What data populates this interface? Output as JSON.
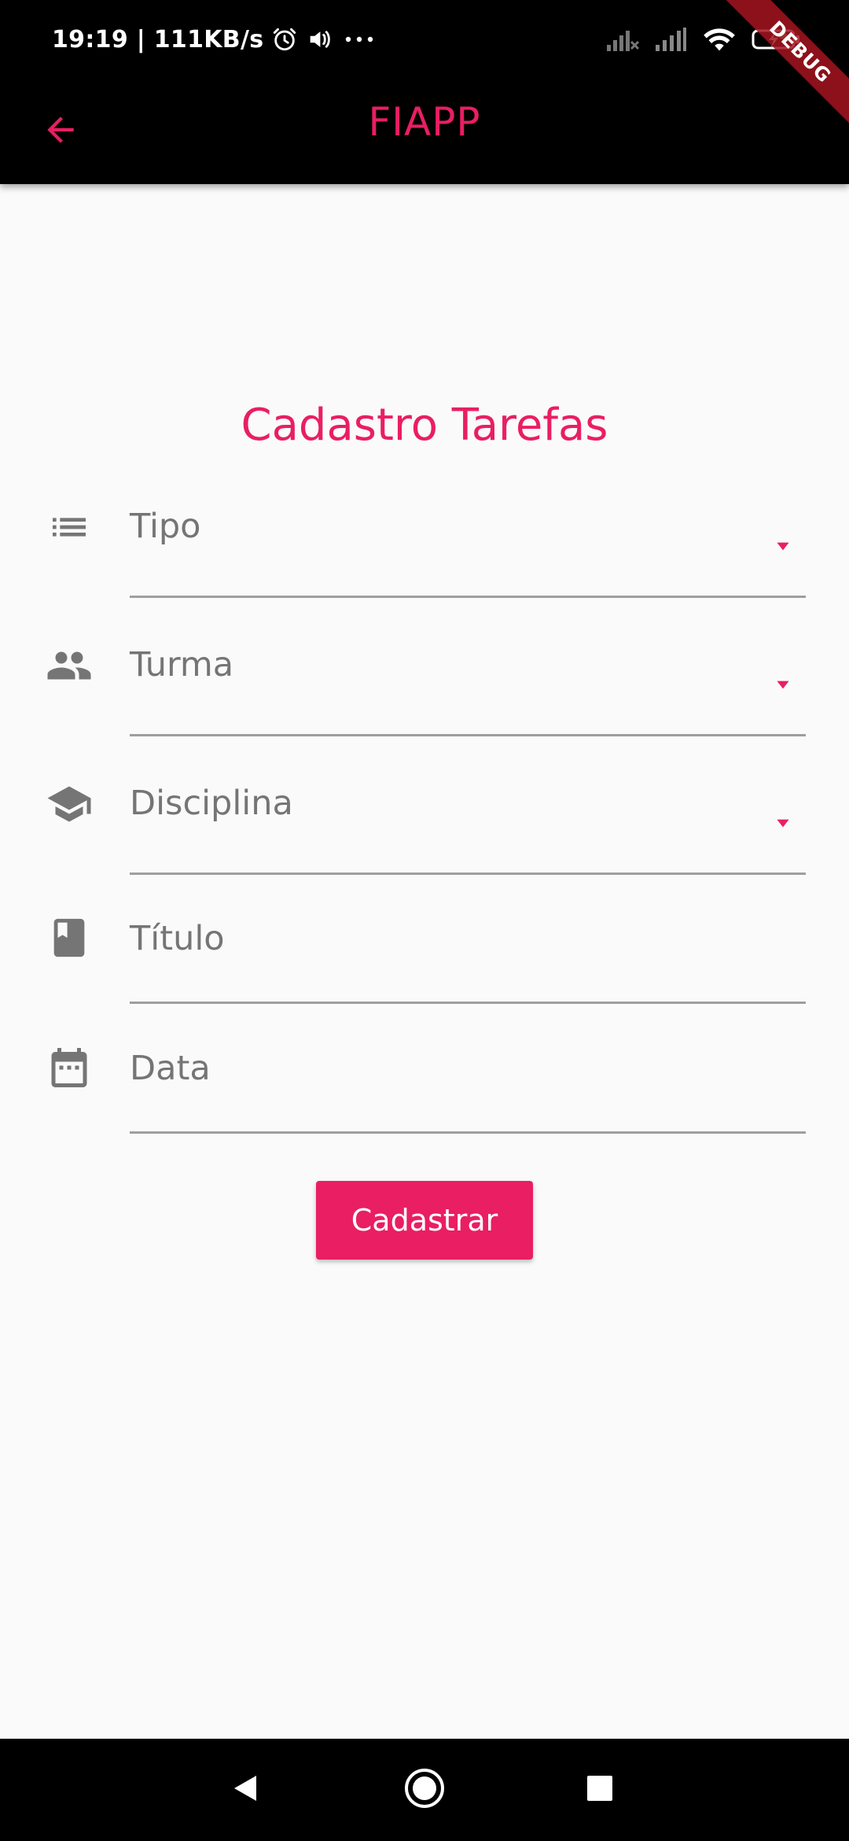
{
  "status_bar": {
    "time": "19:19 | 111KB/s",
    "icons": [
      "alarm-icon",
      "volume-icon",
      "more-dots-icon",
      "signal-no-service-icon",
      "signal-icon",
      "wifi-icon",
      "battery-charging-icon"
    ]
  },
  "app_bar": {
    "title": "FIAPP",
    "back_icon": "arrow-back-icon",
    "debug_label": "DEBUG"
  },
  "form": {
    "title": "Cadastro Tarefas",
    "fields": [
      {
        "label": "Tipo",
        "icon": "list-icon",
        "type": "dropdown"
      },
      {
        "label": "Turma",
        "icon": "people-icon",
        "type": "dropdown"
      },
      {
        "label": "Disciplina",
        "icon": "school-icon",
        "type": "dropdown"
      },
      {
        "label": "Título",
        "icon": "book-icon",
        "type": "text"
      },
      {
        "label": "Data",
        "icon": "calendar-icon",
        "type": "date"
      }
    ],
    "submit_label": "Cadastrar"
  },
  "colors": {
    "accent": "#e91e63",
    "bar_background": "#000000",
    "page_background": "#fafafa",
    "icon_gray": "#757575",
    "underline": "#9e9e9e"
  },
  "nav_bar": {
    "buttons": [
      "back-triangle-icon",
      "home-circle-icon",
      "recents-square-icon"
    ]
  }
}
